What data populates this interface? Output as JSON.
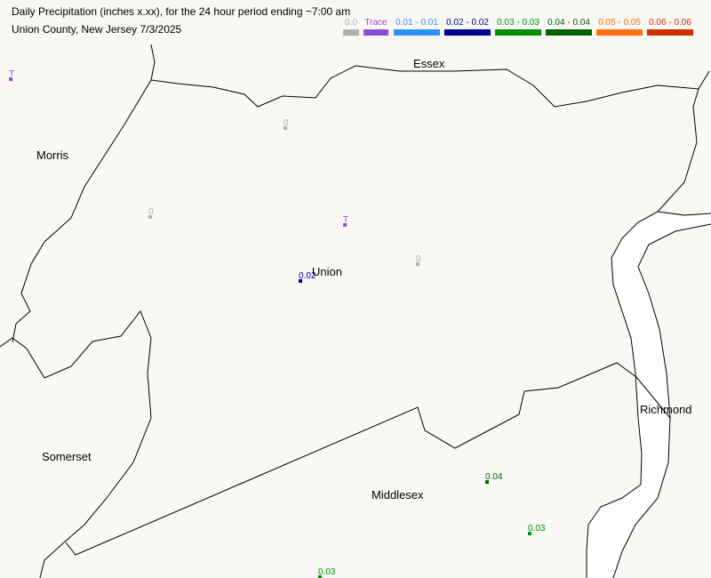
{
  "header": {
    "title": "Daily Precipitation (inches  x.xx),  for the 24 hour period ending ~7:00 am",
    "subtitle": "Union County, New Jersey  7/3/2025"
  },
  "legend": [
    {
      "label": "0.0",
      "color": "#b0b0b0"
    },
    {
      "label": "Trace",
      "color": "#8a4fd0"
    },
    {
      "label": "0.01 - 0.01",
      "color": "#2f8fff"
    },
    {
      "label": "0.02 - 0.02",
      "color": "#000090"
    },
    {
      "label": "0.03 - 0.03",
      "color": "#009000"
    },
    {
      "label": "0.04 - 0.04",
      "color": "#006000"
    },
    {
      "label": "0.05 - 0.05",
      "color": "#ff7010"
    },
    {
      "label": "0.06 - 0.06",
      "color": "#d03000"
    }
  ],
  "map": {
    "land_color": "#f9f8f4",
    "water_color": "#ffffff",
    "counties": [
      "Essex",
      "Morris",
      "Union",
      "Somerset",
      "Middlesex",
      "Richmond"
    ]
  },
  "stations": [
    {
      "label": "T",
      "color": "#8a4fd0"
    },
    {
      "label": "0",
      "color": "#b0b0b0"
    },
    {
      "label": "0",
      "color": "#b0b0b0"
    },
    {
      "label": "T",
      "color": "#8a4fd0"
    },
    {
      "label": "0",
      "color": "#b0b0b0"
    },
    {
      "label": "0.02",
      "color": "#000090"
    },
    {
      "label": "0.04",
      "color": "#006000"
    },
    {
      "label": "0.03",
      "color": "#009000"
    },
    {
      "label": "0.03",
      "color": "#009000"
    }
  ]
}
